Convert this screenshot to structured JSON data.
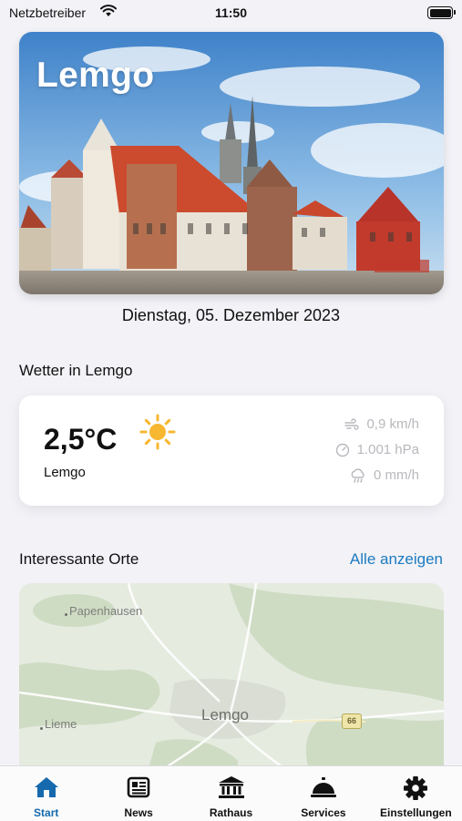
{
  "status_bar": {
    "carrier": "Netzbetreiber",
    "time": "11:50"
  },
  "hero": {
    "title": "Lemgo"
  },
  "date": "Dienstag, 05. Dezember 2023",
  "weather": {
    "section_title": "Wetter in Lemgo",
    "temperature": "2,5°C",
    "city": "Lemgo",
    "wind": "0,9 km/h",
    "pressure": "1.001 hPa",
    "precipitation": "0 mm/h",
    "condition_icon": "sun-icon"
  },
  "places": {
    "section_title": "Interessante Orte",
    "show_all_label": "Alle anzeigen",
    "map_labels": {
      "papenhausen": "Papenhausen",
      "lemgo": "Lemgo",
      "lieme": "Lieme",
      "road": "66"
    }
  },
  "tabs": [
    {
      "label": "Start",
      "icon": "home-icon",
      "active": true
    },
    {
      "label": "News",
      "icon": "newspaper-icon",
      "active": false
    },
    {
      "label": "Rathaus",
      "icon": "town-hall-icon",
      "active": false
    },
    {
      "label": "Services",
      "icon": "service-bell-icon",
      "active": false
    },
    {
      "label": "Einstellungen",
      "icon": "gear-icon",
      "active": false
    }
  ],
  "colors": {
    "accent": "#1669ad",
    "link": "#1e7bbf",
    "background": "#f2f2f7"
  }
}
